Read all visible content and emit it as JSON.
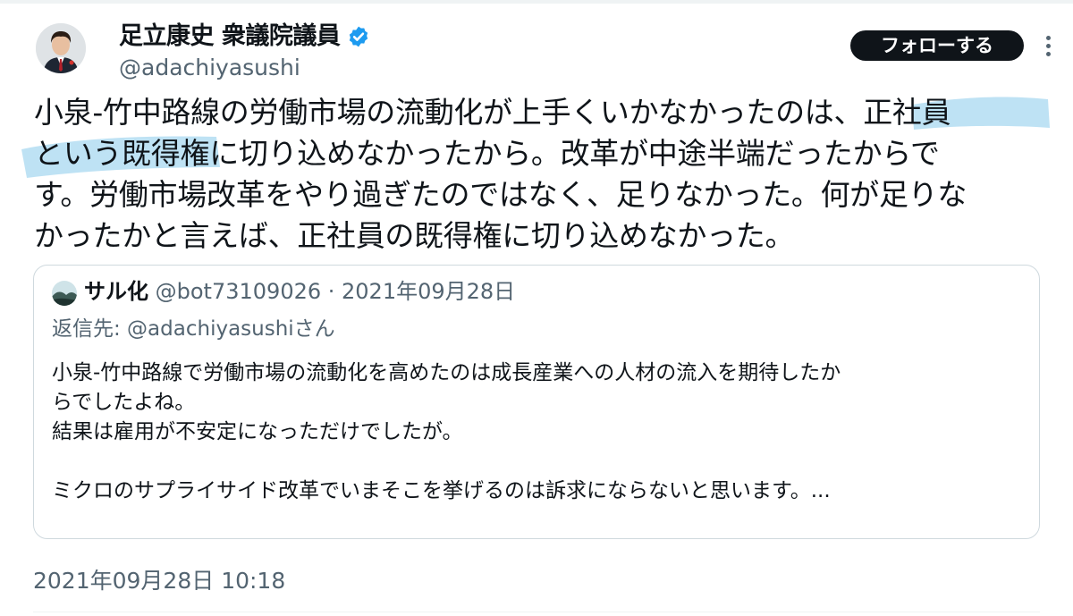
{
  "author": {
    "display_name": "足立康史 衆議院議員",
    "handle": "@adachiyasushi",
    "verified_icon": "verified-badge-icon",
    "avatar": "portrait-avatar"
  },
  "follow_button_label": "フォローする",
  "tweet": {
    "lines": [
      "小泉-竹中路線の労働市場の流動化が上手くいかなかったのは、正社員",
      "という既得権に切り込めなかったから。改革が中途半端だったからで",
      "す。労働市場改革をやり過ぎたのではなく、足りなかった。何が足りな",
      "かったかと言えば、正社員の既得権に切り込めなかった。"
    ],
    "highlighted_phrase": "正社員という既得権",
    "highlight_color": "#a8d8f0"
  },
  "quote": {
    "name": "サル化",
    "meta": "@bot73109026 · 2021年09月28日",
    "reply_to": "返信先: @adachiyasushiさん",
    "body_lines": [
      "小泉-竹中路線で労働市場の流動化を高めたのは成長産業への人材の流入を期待したか",
      "らでしたよね。",
      "結果は雇用が不安定になっただけでしたが。",
      "",
      "ミクロのサプライサイド改革でいまそこを挙げるのは訴求にならないと思います。..."
    ]
  },
  "timestamp": "2021年09月28日 10:18",
  "colors": {
    "text": "#0f1419",
    "secondary": "#536471",
    "border": "#cfd9de",
    "verified": "#1d9bf0",
    "button_bg": "#0f1419"
  }
}
